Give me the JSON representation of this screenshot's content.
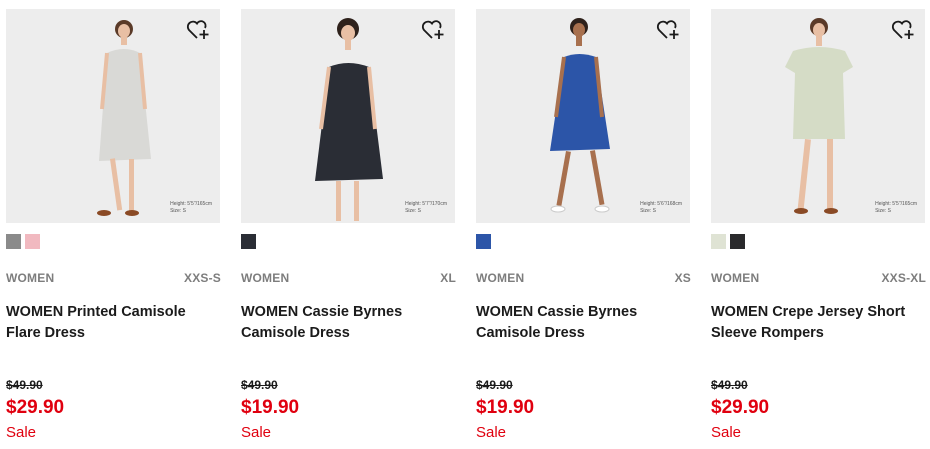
{
  "colors": {
    "sale_red": "#e0000f",
    "muted": "#7d7d7d"
  },
  "products": [
    {
      "height_note": "Height: 5'5\"/165cm",
      "size_note": "Size: S",
      "dress_color": "#d9d9d6",
      "swatches": [
        "#8a8a8a",
        "#f1b9c0"
      ],
      "gender": "WOMEN",
      "size_range": "XXS-S",
      "name": "WOMEN Printed Camisole Flare Dress",
      "original_price": "$49.90",
      "sale_price": "$29.90",
      "sale_label": "Sale"
    },
    {
      "height_note": "Height: 5'7\"/170cm",
      "size_note": "Size: S",
      "dress_color": "#2a2d35",
      "swatches": [
        "#2a2d35"
      ],
      "gender": "WOMEN",
      "size_range": "XL",
      "name": "WOMEN Cassie Byrnes Camisole Dress",
      "original_price": "$49.90",
      "sale_price": "$19.90",
      "sale_label": "Sale"
    },
    {
      "height_note": "Height: 5'6\"/168cm",
      "size_note": "Size: S",
      "dress_color": "#2c55a8",
      "swatches": [
        "#2c55a8"
      ],
      "gender": "WOMEN",
      "size_range": "XS",
      "name": "WOMEN Cassie Byrnes Camisole Dress",
      "original_price": "$49.90",
      "sale_price": "$19.90",
      "sale_label": "Sale"
    },
    {
      "height_note": "Height: 5'5\"/165cm",
      "size_note": "Size: S",
      "dress_color": "#d5dcc6",
      "swatches": [
        "#dfe3d4",
        "#2a2a2c"
      ],
      "gender": "WOMEN",
      "size_range": "XXS-XL",
      "name": "WOMEN Crepe Jersey Short Sleeve Rompers",
      "original_price": "$49.90",
      "sale_price": "$29.90",
      "sale_label": "Sale"
    }
  ]
}
